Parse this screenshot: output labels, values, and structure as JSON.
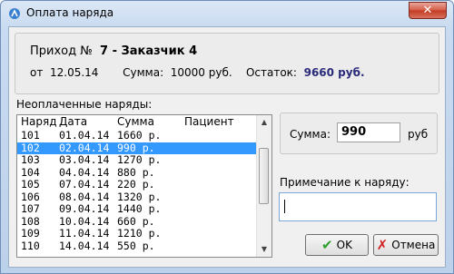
{
  "window": {
    "title": "Оплата наряда",
    "icon": "app-icon",
    "close_glyph": "✕"
  },
  "info": {
    "prihod_label": "Приход №",
    "prihod_value": "7 - Заказчик 4",
    "date_label": "от",
    "date_value": "12.05.14",
    "sum_label": "Сумма:",
    "sum_value": "10000 руб.",
    "remainder_label": "Остаток:",
    "remainder_value": "9660 руб."
  },
  "list": {
    "caption": "Неоплаченные наряды:",
    "columns": [
      "Наряд",
      "Дата",
      "Сумма",
      "Пациент"
    ],
    "rows": [
      {
        "id": "101",
        "date": "01.04.14",
        "sum": "1660 р.",
        "patient": ""
      },
      {
        "id": "102",
        "date": "02.04.14",
        "sum": "990 р.",
        "patient": "",
        "selected": true
      },
      {
        "id": "103",
        "date": "03.04.14",
        "sum": "1270 р.",
        "patient": ""
      },
      {
        "id": "104",
        "date": "04.04.14",
        "sum": "880 р.",
        "patient": ""
      },
      {
        "id": "105",
        "date": "07.04.14",
        "sum": "220 р.",
        "patient": ""
      },
      {
        "id": "106",
        "date": "08.04.14",
        "sum": "1320 р.",
        "patient": ""
      },
      {
        "id": "107",
        "date": "09.04.14",
        "sum": "1440 р.",
        "patient": ""
      },
      {
        "id": "108",
        "date": "10.04.14",
        "sum": "660 р.",
        "patient": ""
      },
      {
        "id": "109",
        "date": "11.04.14",
        "sum": "1210 р.",
        "patient": ""
      },
      {
        "id": "110",
        "date": "14.04.14",
        "sum": "550 р.",
        "patient": ""
      }
    ]
  },
  "payment": {
    "sum_label": "Сумма:",
    "sum_value": "990",
    "unit": "руб"
  },
  "note": {
    "label": "Примечание к наряду:",
    "value": ""
  },
  "buttons": {
    "ok": "OK",
    "cancel": "Отмена"
  },
  "colors": {
    "selection": "#3399ff",
    "remainder": "#2a2a7a",
    "ok_icon": "#2ea02e",
    "cancel_icon": "#d02020"
  }
}
